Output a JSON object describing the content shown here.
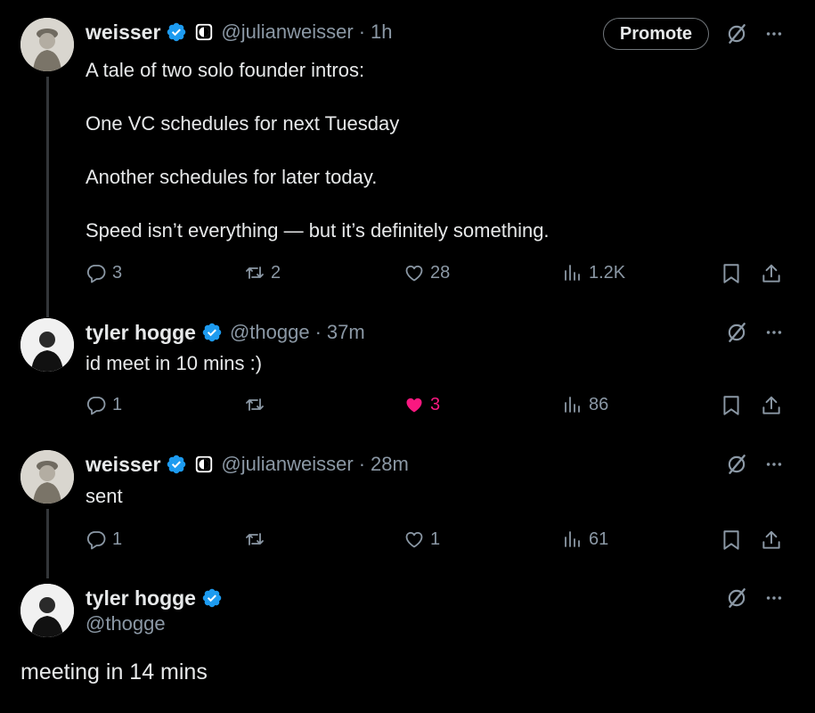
{
  "tweets": [
    {
      "name": "weisser",
      "handle": "@julianweisser",
      "time": "1h",
      "promote": "Promote",
      "lines": [
        "A tale of two solo founder intros:",
        "One VC schedules for next Tuesday",
        "Another schedules for later today.",
        "Speed isn’t everything — but it’s definitely something."
      ],
      "replies": "3",
      "reposts": "2",
      "likes": "28",
      "views": "1.2K"
    },
    {
      "name": "tyler hogge",
      "handle": "@thogge",
      "time": "37m",
      "text": "id meet in 10 mins :)",
      "replies": "1",
      "likes": "3",
      "views": "86"
    },
    {
      "name": "weisser",
      "handle": "@julianweisser",
      "time": "28m",
      "text": "sent",
      "replies": "1",
      "likes": "1",
      "views": "61"
    },
    {
      "name": "tyler hogge",
      "handle": "@thogge",
      "text": "meeting in 14 mins"
    }
  ],
  "colors": {
    "background": "#000000",
    "text": "#e7e9ea",
    "muted": "#8b98a5",
    "verified": "#1d9bf0",
    "like": "#f91880"
  },
  "icons": [
    "verified-badge-icon",
    "org-badge-icon",
    "grok-icon",
    "more-icon",
    "reply-icon",
    "repost-icon",
    "like-icon",
    "views-icon",
    "bookmark-icon",
    "share-icon"
  ]
}
